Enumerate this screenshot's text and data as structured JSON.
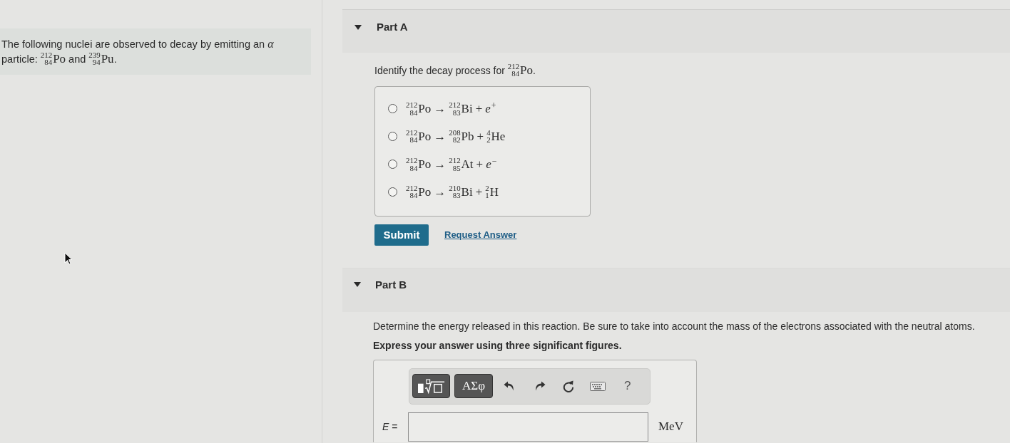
{
  "problem": {
    "segments": [
      {
        "kind": "text",
        "text": "The following nuclei are observed to decay by emitting an "
      },
      {
        "kind": "symbol",
        "text": "α"
      },
      {
        "kind": "text",
        "text": " particle: "
      },
      {
        "kind": "nuclide",
        "mass": "212",
        "number": "84",
        "symbol": "Po"
      },
      {
        "kind": "text",
        "text": " and "
      },
      {
        "kind": "nuclide",
        "mass": "239",
        "number": "94",
        "symbol": "Pu"
      },
      {
        "kind": "text",
        "text": "."
      }
    ]
  },
  "parts": [
    {
      "kind": "multiple_choice",
      "label": "Part A",
      "expanded": true,
      "prompt": [
        {
          "kind": "text",
          "text": "Identify the decay process for "
        },
        {
          "kind": "nuclide",
          "mass": "212",
          "number": "84",
          "symbol": "Po"
        },
        {
          "kind": "text",
          "text": "."
        }
      ],
      "options": [
        {
          "selected": false,
          "terms": [
            {
              "kind": "nuclide",
              "mass": "212",
              "number": "84",
              "symbol": "Po"
            },
            {
              "kind": "operator",
              "text": "→"
            },
            {
              "kind": "nuclide",
              "mass": "212",
              "number": "83",
              "symbol": "Bi"
            },
            {
              "kind": "operator",
              "text": "+"
            },
            {
              "kind": "particle",
              "symbol": "e",
              "charge": "+"
            }
          ]
        },
        {
          "selected": false,
          "terms": [
            {
              "kind": "nuclide",
              "mass": "212",
              "number": "84",
              "symbol": "Po"
            },
            {
              "kind": "operator",
              "text": "→"
            },
            {
              "kind": "nuclide",
              "mass": "208",
              "number": "82",
              "symbol": "Pb"
            },
            {
              "kind": "operator",
              "text": "+"
            },
            {
              "kind": "nuclide",
              "mass": "4",
              "number": "2",
              "symbol": "He"
            }
          ]
        },
        {
          "selected": false,
          "terms": [
            {
              "kind": "nuclide",
              "mass": "212",
              "number": "84",
              "symbol": "Po"
            },
            {
              "kind": "operator",
              "text": "→"
            },
            {
              "kind": "nuclide",
              "mass": "212",
              "number": "85",
              "symbol": "At"
            },
            {
              "kind": "operator",
              "text": "+"
            },
            {
              "kind": "particle",
              "symbol": "e",
              "charge": "−"
            }
          ]
        },
        {
          "selected": false,
          "terms": [
            {
              "kind": "nuclide",
              "mass": "212",
              "number": "84",
              "symbol": "Po"
            },
            {
              "kind": "operator",
              "text": "→"
            },
            {
              "kind": "nuclide",
              "mass": "210",
              "number": "83",
              "symbol": "Bi"
            },
            {
              "kind": "operator",
              "text": "+"
            },
            {
              "kind": "nuclide",
              "mass": "2",
              "number": "1",
              "symbol": "H"
            }
          ]
        }
      ],
      "submit_button": "Submit",
      "request_link": "Request Answer"
    },
    {
      "kind": "numeric",
      "label": "Part B",
      "expanded": true,
      "prompt": "Determine the energy released in this reaction. Be sure to take into account the mass of the electrons associated with the neutral atoms.",
      "instruction": "Express your answer using three significant figures.",
      "toolbar": {
        "symbols_button": "ΑΣφ",
        "help_button": "?"
      },
      "answer": {
        "label": "*E* =",
        "unit": "MeV"
      }
    }
  ]
}
